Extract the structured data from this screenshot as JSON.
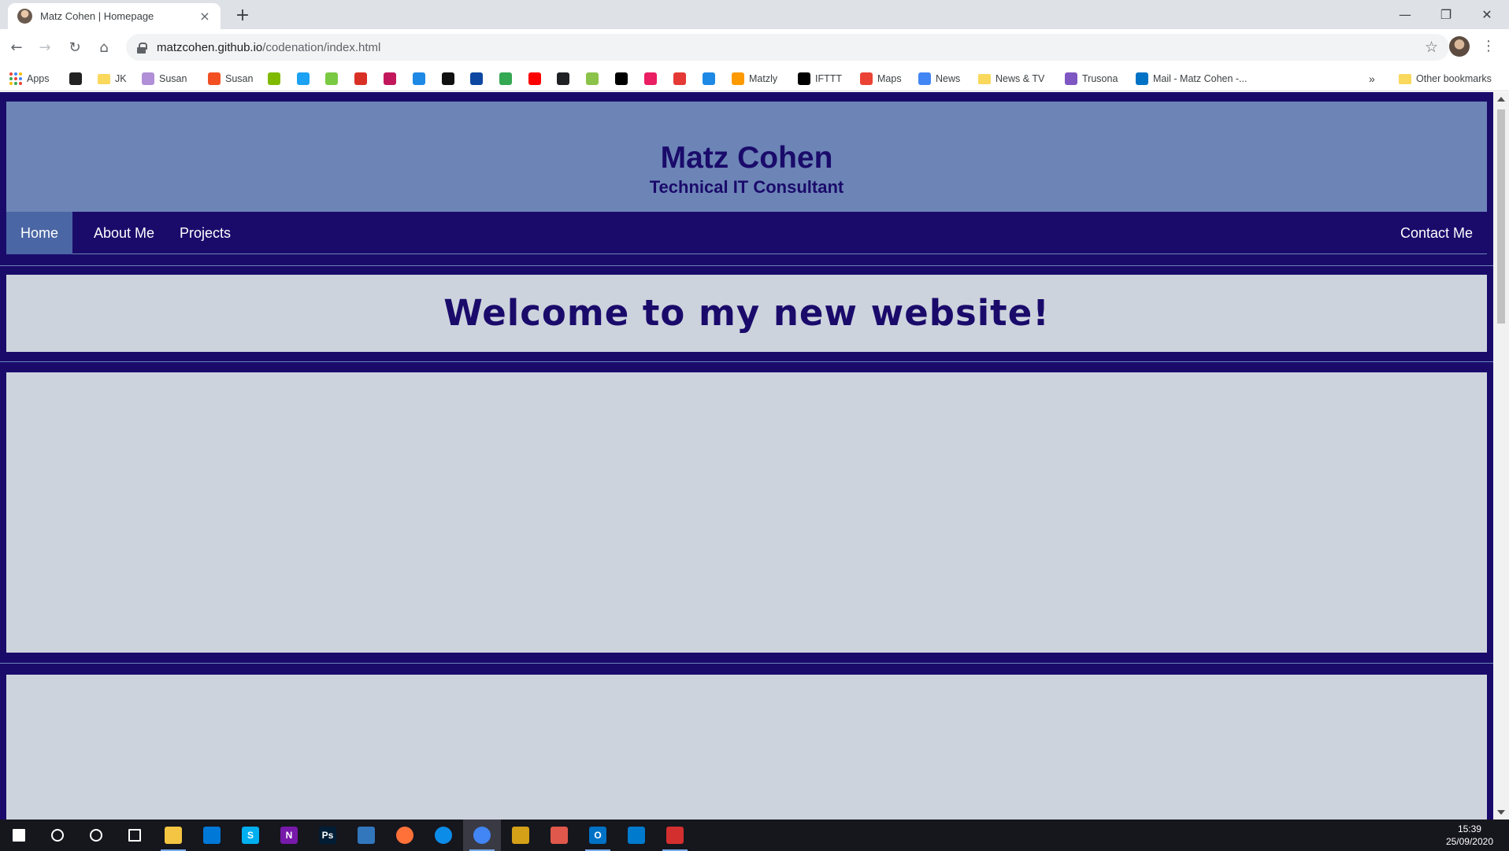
{
  "browser": {
    "tab_title": "Matz Cohen | Homepage",
    "tab_close": "×",
    "new_tab": "+",
    "window_controls": {
      "minimize": "—",
      "restore": "❐",
      "close": "✕"
    },
    "nav": {
      "back": "←",
      "forward": "→",
      "reload": "↻",
      "home": "⌂"
    },
    "url_host": "matzcohen.github.io",
    "url_path": "/codenation/index.html",
    "bookmark_star": "☆",
    "menu": "⋮"
  },
  "bookmarks": {
    "apps_label": "Apps",
    "items": [
      {
        "label": "",
        "icon": "a",
        "color": "#222222"
      },
      {
        "label": "JK",
        "icon": "folder",
        "color": "#f9d85c"
      },
      {
        "label": "Susan",
        "icon": "W",
        "color": "#b08fd8"
      },
      {
        "label": "Susan",
        "icon": "ms",
        "color": "#f25022"
      },
      {
        "label": "",
        "icon": "ms",
        "color": "#7fba00"
      },
      {
        "label": "",
        "icon": "t",
        "color": "#1da1f2"
      },
      {
        "label": "",
        "icon": "oo",
        "color": "#7ac943"
      },
      {
        "label": "",
        "icon": "M",
        "color": "#d93025"
      },
      {
        "label": "",
        "icon": "sky",
        "color": "#c2185b"
      },
      {
        "label": "",
        "icon": "X",
        "color": "#1e88e5"
      },
      {
        "label": "",
        "icon": "lol",
        "color": "#111111"
      },
      {
        "label": "",
        "icon": "UN",
        "color": "#0d47a1"
      },
      {
        "label": "",
        "icon": "map",
        "color": "#34a853"
      },
      {
        "label": "",
        "icon": "yt",
        "color": "#ff0000"
      },
      {
        "label": "",
        "icon": "ring",
        "color": "#202124"
      },
      {
        "label": "",
        "icon": "W",
        "color": "#8bc34a"
      },
      {
        "label": "",
        "icon": "I",
        "color": "#000000"
      },
      {
        "label": "",
        "icon": "play",
        "color": "#e91e63"
      },
      {
        "label": "",
        "icon": "Rai",
        "color": "#e53935"
      },
      {
        "label": "",
        "icon": "p",
        "color": "#1e88e5"
      },
      {
        "label": "Matzly",
        "icon": "a",
        "color": "#ff9900"
      },
      {
        "label": "IFTTT",
        "icon": "if",
        "color": "#000000"
      },
      {
        "label": "Maps",
        "icon": "pin",
        "color": "#ea4335"
      },
      {
        "label": "News",
        "icon": "G",
        "color": "#4285f4"
      },
      {
        "label": "News & TV",
        "icon": "folder",
        "color": "#f9d85c"
      },
      {
        "label": "Trusona",
        "icon": "T",
        "color": "#7e57c2"
      },
      {
        "label": "Mail - Matz Cohen -...",
        "icon": "O",
        "color": "#0072c6"
      }
    ],
    "overflow": "»",
    "other_label": "Other bookmarks"
  },
  "site": {
    "name": "Matz Cohen",
    "tagline": "Technical IT Consultant",
    "nav": {
      "home": "Home",
      "about": "About Me",
      "projects": "Projects",
      "contact": "Contact Me"
    },
    "welcome": "Welcome to my new website!"
  },
  "colors": {
    "site_primary": "#1a0b6b",
    "site_header": "#6c85b6",
    "site_active_nav": "#4a66a4",
    "site_panel": "#cdd3dd"
  },
  "taskbar": {
    "time": "15:39",
    "date": "25/09/2020",
    "apps": [
      {
        "name": "start-icon"
      },
      {
        "name": "search-icon"
      },
      {
        "name": "cortana-icon"
      },
      {
        "name": "task-view-icon"
      },
      {
        "name": "file-explorer-icon"
      },
      {
        "name": "store-icon"
      },
      {
        "name": "skype-icon",
        "text": "S"
      },
      {
        "name": "onenote-icon",
        "text": "N"
      },
      {
        "name": "photoshop-icon",
        "text": "Ps"
      },
      {
        "name": "edge-legacy-icon"
      },
      {
        "name": "firefox-icon"
      },
      {
        "name": "edge-icon"
      },
      {
        "name": "chrome-icon"
      },
      {
        "name": "paint-icon"
      },
      {
        "name": "snip-icon"
      },
      {
        "name": "outlook-icon",
        "text": "O"
      },
      {
        "name": "vscode-icon"
      },
      {
        "name": "acrobat-icon"
      }
    ]
  }
}
